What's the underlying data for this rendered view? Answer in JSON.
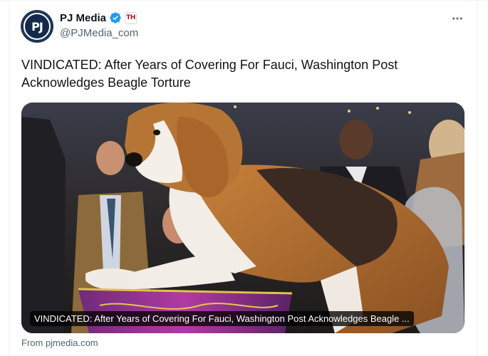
{
  "tweet": {
    "author": {
      "display_name": "PJ Media",
      "handle": "@PJMedia_com",
      "avatar_text": "PJ",
      "affiliate_badge_text": "TH",
      "verified": true
    },
    "text": "VINDICATED: After Years of Covering For Fauci, Washington Post Acknowledges Beagle Torture",
    "card": {
      "caption": "VINDICATED: After Years of Covering For Fauci, Washington Post Acknowledges Beagle ...",
      "source": "From pjmedia.com"
    }
  },
  "colors": {
    "verified_blue": "#1d9bf0",
    "secondary_text": "#536471",
    "primary_text": "#0f1419",
    "avatar_navy": "#1d3557",
    "badge_red": "#b5121b"
  },
  "icons": [
    "verified-icon",
    "more-options-icon"
  ]
}
